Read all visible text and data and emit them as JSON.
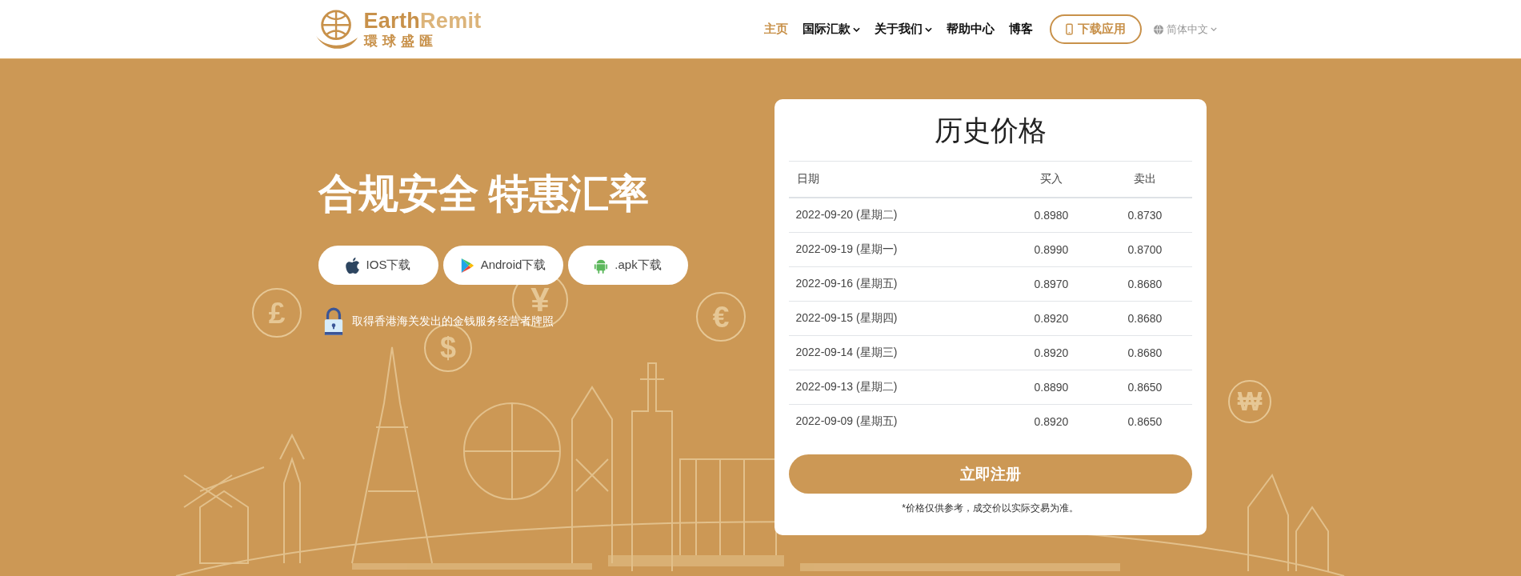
{
  "logo": {
    "name_first": "Earth",
    "name_second": "Remit",
    "subtitle": "環球盛匯"
  },
  "nav": [
    {
      "label": "主页",
      "selected": true,
      "dropdown": false
    },
    {
      "label": "国际汇款",
      "selected": false,
      "dropdown": true
    },
    {
      "label": "关于我们",
      "selected": false,
      "dropdown": true
    },
    {
      "label": "帮助中心",
      "selected": false,
      "dropdown": false
    },
    {
      "label": "博客",
      "selected": false,
      "dropdown": false
    }
  ],
  "download_button": "下载应用",
  "language": "简体中文",
  "hero": {
    "heading": "合规安全 特惠汇率",
    "app_buttons": [
      {
        "kind": "ios",
        "label": "IOS下载"
      },
      {
        "kind": "android",
        "label": "Android下载"
      },
      {
        "kind": "apk",
        "label": ".apk下载"
      }
    ],
    "license": "取得香港海关发出的金钱服务经营者牌照",
    "currency_symbols": [
      "£",
      "$",
      "¥",
      "€",
      "₩"
    ]
  },
  "price_card": {
    "title": "历史价格",
    "columns": [
      "日期",
      "买入",
      "卖出"
    ],
    "rows": [
      [
        "2022-09-20 (星期二)",
        "0.8980",
        "0.8730"
      ],
      [
        "2022-09-19 (星期一)",
        "0.8990",
        "0.8700"
      ],
      [
        "2022-09-16 (星期五)",
        "0.8970",
        "0.8680"
      ],
      [
        "2022-09-15 (星期四)",
        "0.8920",
        "0.8680"
      ],
      [
        "2022-09-14 (星期三)",
        "0.8920",
        "0.8680"
      ],
      [
        "2022-09-13 (星期二)",
        "0.8890",
        "0.8650"
      ],
      [
        "2022-09-09 (星期五)",
        "0.8920",
        "0.8650"
      ]
    ],
    "register_button": "立即注册",
    "note": "*价格仅供参考，成交价以实际交易为准。"
  }
}
